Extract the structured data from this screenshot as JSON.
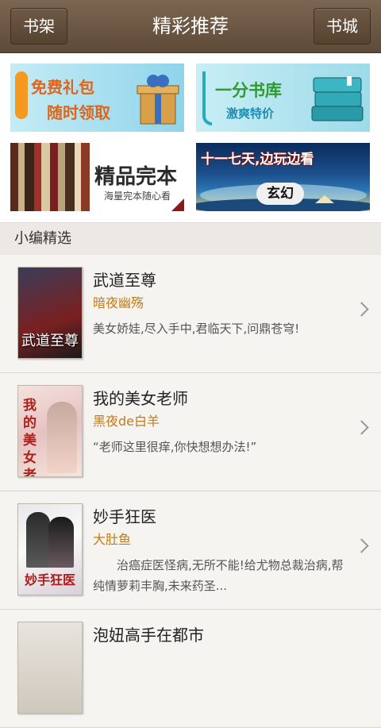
{
  "header": {
    "left_button": "书架",
    "title": "精彩推荐",
    "right_button": "书城"
  },
  "banners": [
    {
      "line1": "免费礼包",
      "line2": "随时领取",
      "icon": "gift-icon"
    },
    {
      "line1": "一分书库",
      "line2": "激爽特价",
      "icon": "books-icon"
    },
    {
      "line1": "精品完本",
      "line2": "海量完本随心看",
      "icon": "bookshelf-image"
    },
    {
      "line1": "十一七天,边玩边看",
      "line2": "玄幻",
      "icon": "night-sky-image"
    }
  ],
  "section": {
    "title": "小编精选"
  },
  "books": [
    {
      "title": "武道至尊",
      "author": "暗夜幽殇",
      "desc": "美女娇娃,尽入手中,君临天下,问鼎苍穹!",
      "cover_text": "武道至尊"
    },
    {
      "title": "我的美女老师",
      "author": "黑夜de白羊",
      "desc": "“老师这里很痒,你快想想办法!”",
      "cover_text": "我的美女老师"
    },
    {
      "title": "妙手狂医",
      "author": "大肚鱼",
      "desc": "　　治癌症医怪病,无所不能!给尤物总裁治病,帮纯情萝莉丰胸,未来药圣...",
      "cover_text": "妙手狂医"
    },
    {
      "title": "泡妞高手在都市",
      "author": "",
      "desc": "",
      "cover_text": ""
    }
  ],
  "colors": {
    "header_bg": "#6b5643",
    "author": "#c07b1a",
    "section_bg": "#ece9e4"
  }
}
